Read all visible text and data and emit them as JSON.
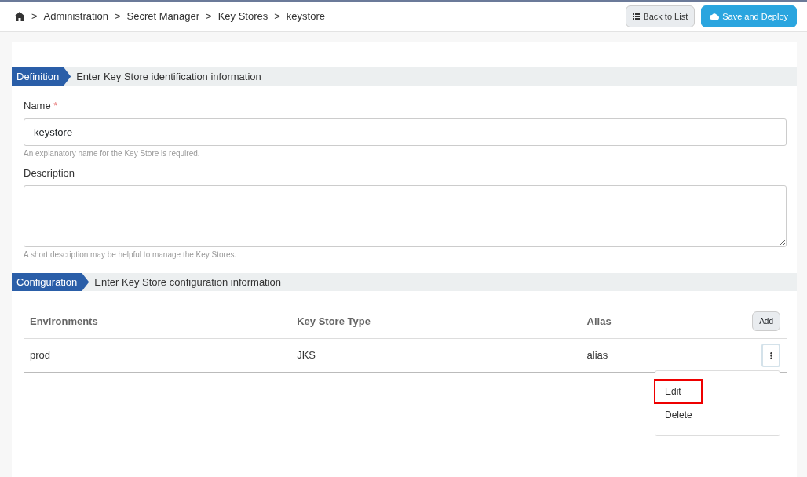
{
  "breadcrumb": {
    "separator": ">",
    "items": [
      "Administration",
      "Secret Manager",
      "Key Stores"
    ],
    "current": "keystore"
  },
  "header_buttons": [
    {
      "kind": "list",
      "label": "Back to List"
    },
    {
      "kind": "cloud",
      "label": "Save and Deploy"
    }
  ],
  "sections": [
    {
      "tag": "Definition",
      "description": "Enter Key Store identification information"
    },
    {
      "tag": "Configuration",
      "description": "Enter Key Store configuration information"
    }
  ],
  "name_field": {
    "label": "Name",
    "required_mark": "*",
    "value": "keystore",
    "help": "An explanatory name for the Key Store is required."
  },
  "description_field": {
    "label": "Description",
    "help": "A short description may be helpful to manage the Key Stores."
  },
  "table": {
    "columns": [
      "Environments",
      "Key Store Type",
      "Alias"
    ],
    "add_button": "Add",
    "rows": [
      {
        "cells": [
          "prod",
          "JKS",
          "alias"
        ],
        "menu_open": true
      }
    ]
  },
  "row_menu": [
    {
      "label": "Edit",
      "highlighted": true
    },
    {
      "label": "Delete",
      "highlighted": false
    }
  ]
}
